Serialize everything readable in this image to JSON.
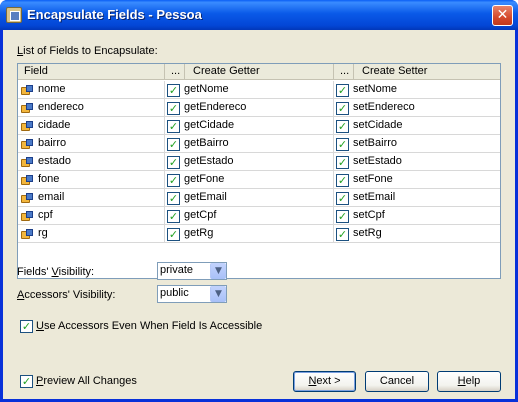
{
  "window": {
    "title": "Encapsulate Fields - Pessoa",
    "close_glyph": "✕"
  },
  "fields_list": {
    "label": "List of Fields to Encapsulate:",
    "label_prefix": "L",
    "label_rest": "ist of Fields to Encapsulate:",
    "columns": {
      "field": "Field",
      "getter_ellipsis": "...",
      "getter": "Create Getter",
      "setter_ellipsis": "...",
      "setter": "Create Setter"
    },
    "rows": [
      {
        "field": "nome",
        "getter": "getNome",
        "setter": "setNome"
      },
      {
        "field": "endereco",
        "getter": "getEndereco",
        "setter": "setEndereco"
      },
      {
        "field": "cidade",
        "getter": "getCidade",
        "setter": "setCidade"
      },
      {
        "field": "bairro",
        "getter": "getBairro",
        "setter": "setBairro"
      },
      {
        "field": "estado",
        "getter": "getEstado",
        "setter": "setEstado"
      },
      {
        "field": "fone",
        "getter": "getFone",
        "setter": "setFone"
      },
      {
        "field": "email",
        "getter": "getEmail",
        "setter": "setEmail"
      },
      {
        "field": "cpf",
        "getter": "getCpf",
        "setter": "setCpf"
      },
      {
        "field": "rg",
        "getter": "getRg",
        "setter": "setRg"
      }
    ],
    "check_glyph": "✓"
  },
  "fields_visibility": {
    "label_pre": "Fields' ",
    "label_u": "V",
    "label_post": "isibility:",
    "value": "private"
  },
  "accessors_visibility": {
    "label_u": "A",
    "label_post": "ccessors' Visibility:",
    "value": "public"
  },
  "use_accessors": {
    "label_u": "U",
    "label_post": "se Accessors Even When Field Is Accessible",
    "checked": true
  },
  "preview": {
    "label_u": "P",
    "label_post": "review All Changes",
    "checked": true
  },
  "buttons": {
    "next_u": "N",
    "next_post": "ext >",
    "cancel": "Cancel",
    "help_u": "H",
    "help_post": "elp"
  },
  "icons": {
    "combo_arrow": "▼",
    "title_icon": "encapsulate-fields-icon",
    "field_icon": "field-icon"
  },
  "colors": {
    "titlebar": "#0a5ae8",
    "client_bg": "#ece9d8",
    "check": "#21a121"
  }
}
